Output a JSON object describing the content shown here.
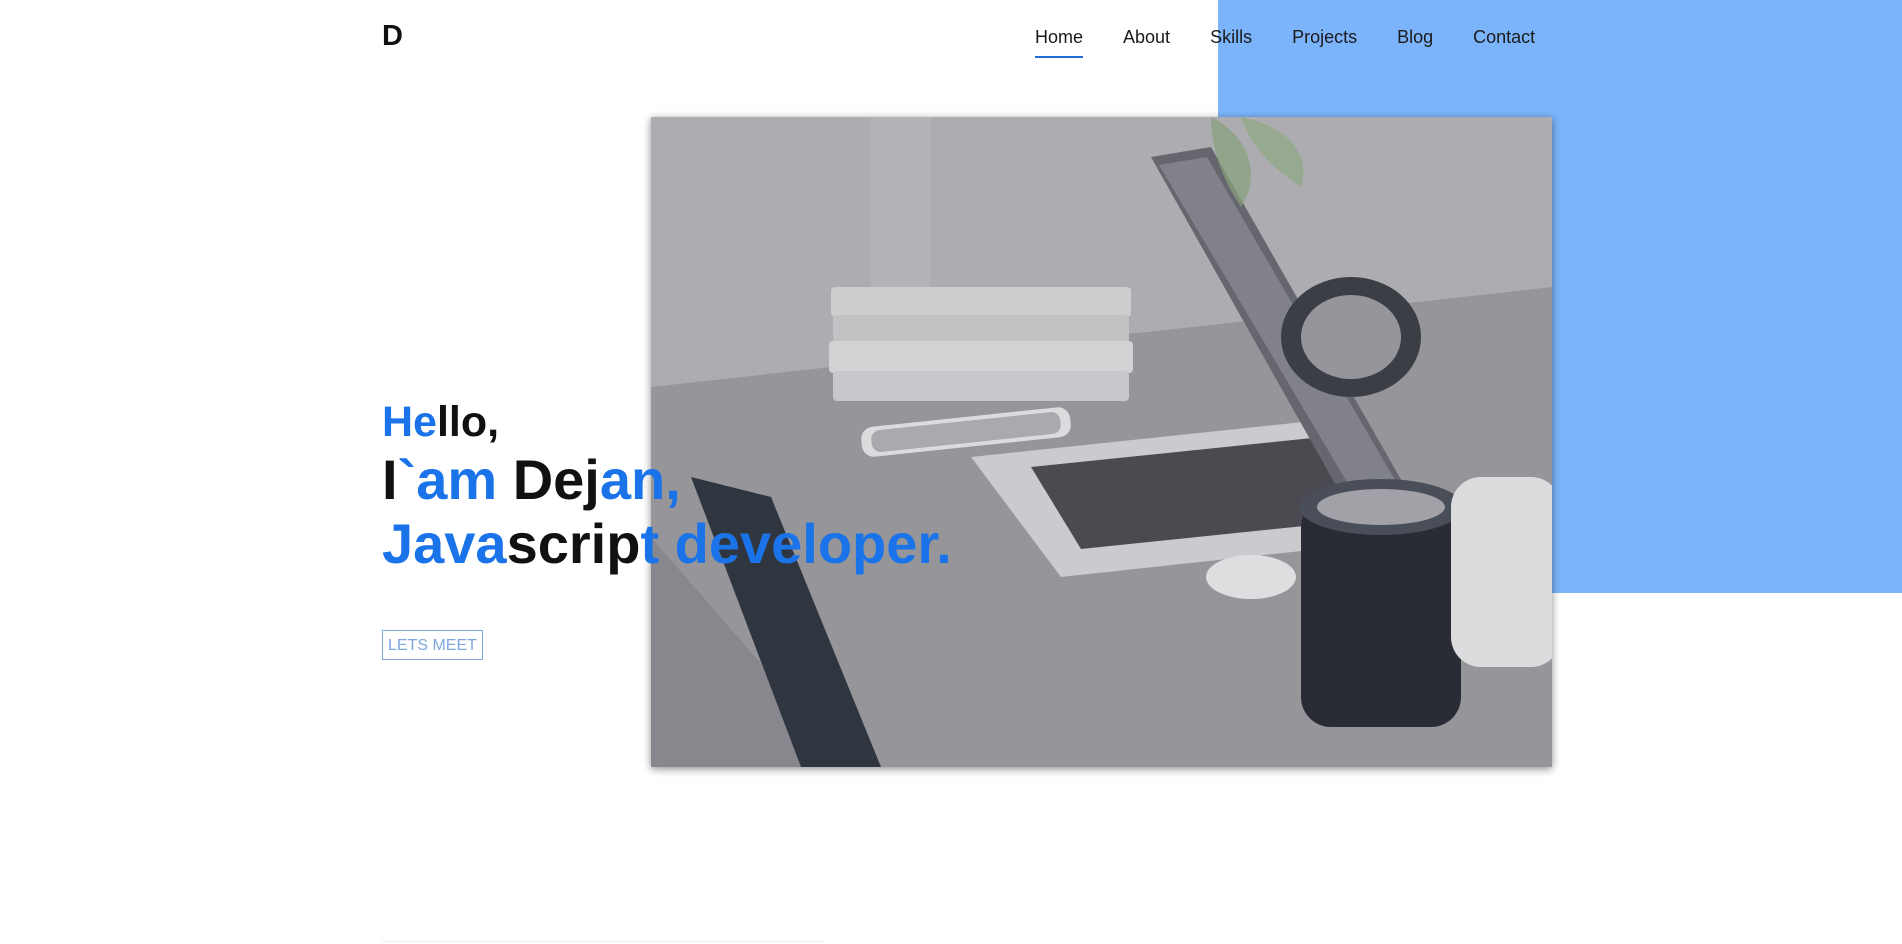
{
  "logo": {
    "text": "D"
  },
  "nav": {
    "items": [
      {
        "label": "Home",
        "active": true
      },
      {
        "label": "About"
      },
      {
        "label": "Skills"
      },
      {
        "label": "Projects"
      },
      {
        "label": "Blog"
      },
      {
        "label": "Contact"
      }
    ]
  },
  "hero": {
    "line1": [
      {
        "text": "He",
        "blue": true
      },
      {
        "text": "llo,",
        "blue": false
      }
    ],
    "line2": [
      {
        "text": "I",
        "blue": false
      },
      {
        "text": "`am",
        "blue": true
      },
      {
        "text": " Dej",
        "blue": false
      },
      {
        "text": "an,",
        "blue": true
      }
    ],
    "line3": [
      {
        "text": "Java",
        "blue": true
      },
      {
        "text": "scrip",
        "blue": false
      },
      {
        "text": "t developer.",
        "blue": true
      }
    ],
    "cta_label": "LETS MEET",
    "photo_icon": "laptop-desk-photo"
  },
  "colors": {
    "accent": "#1a73e8",
    "block": "#7cb4fb",
    "cta": "#7ea7e0"
  }
}
